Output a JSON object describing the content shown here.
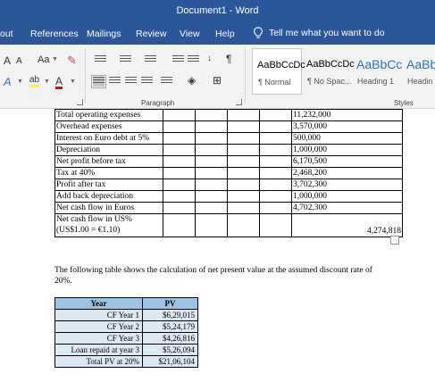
{
  "window": {
    "title": "Document1  -  Word"
  },
  "tabs": [
    "out",
    "References",
    "Mailings",
    "Review",
    "View",
    "Help"
  ],
  "tell_me": "Tell me what you want to do",
  "ribbon": {
    "font_buttons": {
      "grow": "A",
      "shrink": "A",
      "case": "Aa",
      "clear": "A",
      "effects": "A",
      "highlight": "ab",
      "color": "A"
    },
    "paragraph_label": "Paragraph",
    "styles_label": "Styles",
    "styles": [
      {
        "sample": "AaBbCcDc",
        "name": "¶ Normal"
      },
      {
        "sample": "AaBbCcDc",
        "name": "¶ No Spac..."
      },
      {
        "sample": "AaBbCc",
        "name": "Heading 1"
      },
      {
        "sample": "AaBbCc",
        "name": "Headin"
      }
    ]
  },
  "document": {
    "table1": {
      "rows": [
        {
          "label": "Total operating expenses",
          "value": "11,232,000"
        },
        {
          "label": "Overhead expenses",
          "value": "3,570,000"
        },
        {
          "label": "Interest on Euro debt at 5%",
          "value": "500,000"
        },
        {
          "label": "Depreciation",
          "value": "1,000,000"
        },
        {
          "label": "Net profit before tax",
          "value": "6,170,500"
        },
        {
          "label": "Tax at 40%",
          "value": "2,468,200"
        },
        {
          "label": "Profit after tax",
          "value": "3,702,300"
        },
        {
          "label": "Add back depreciation",
          "value": "1,000,000"
        },
        {
          "label": "Net cash flow in Euros",
          "value": "4,702,300"
        }
      ],
      "last_row": {
        "label_line1": "Net cash flow in US%",
        "label_line2": "(US$1.00 = €1.10)",
        "value": "4,274,818"
      }
    },
    "paragraph": "The following table shows the calculation of net present value at the assumed discount rate of 20%.",
    "table2": {
      "headers": [
        "Year",
        "PV"
      ],
      "rows": [
        {
          "label": "CF Year 1",
          "value": "$6,29,015"
        },
        {
          "label": "CF Year 2",
          "value": "$5,24,179"
        },
        {
          "label": "CF Year 3",
          "value": "$4,26,816"
        },
        {
          "label": "Loan repaid at year 3",
          "value": "$5,26,094"
        },
        {
          "label": "Total PV at 20%",
          "value": "$21,06,104"
        }
      ]
    }
  }
}
